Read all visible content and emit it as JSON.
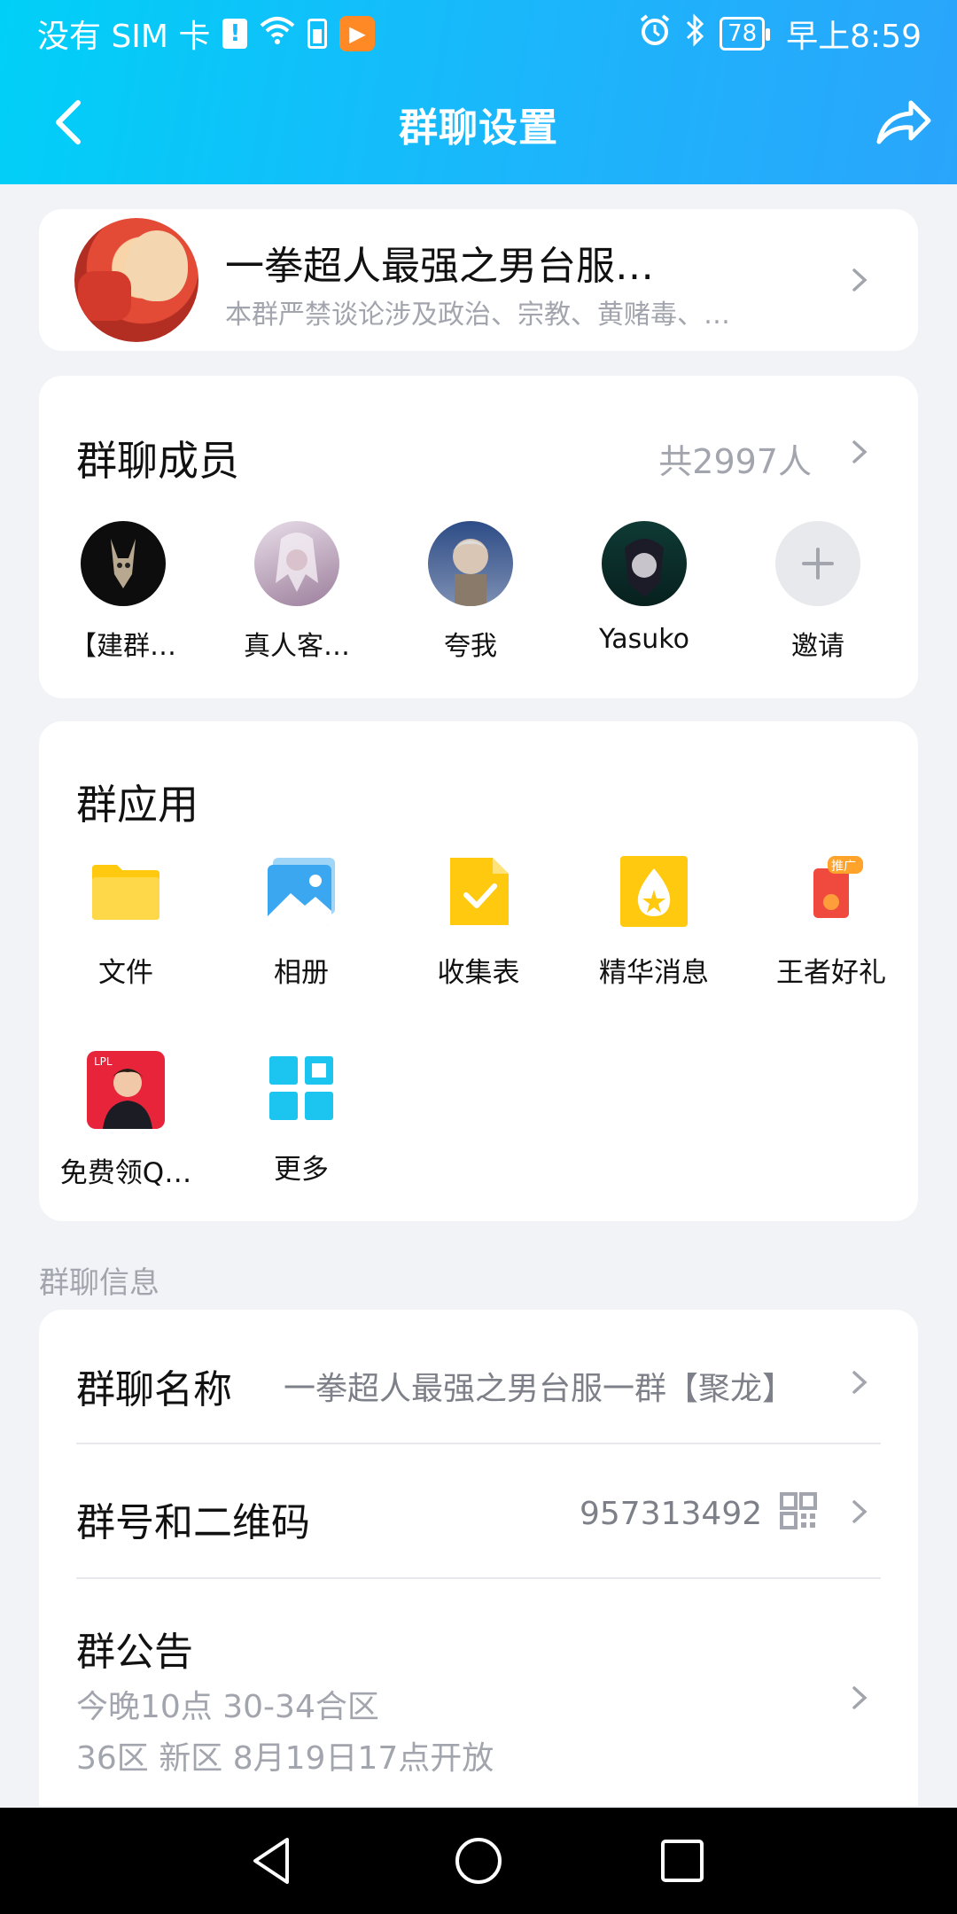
{
  "status_bar": {
    "carrier": "没有 SIM 卡",
    "battery": "78",
    "time": "早上8:59"
  },
  "header": {
    "title": "群聊设置"
  },
  "group": {
    "name": "一拳超人最强之男台服…",
    "description": "本群严禁谈论涉及政治、宗教、黄赌毒、…"
  },
  "members": {
    "title": "群聊成员",
    "count": "共2997人",
    "list": [
      {
        "name": "【建群…"
      },
      {
        "name": "真人客…"
      },
      {
        "name": "夸我"
      },
      {
        "name": "Yasuko"
      },
      {
        "name": "邀请"
      }
    ]
  },
  "apps": {
    "title": "群应用",
    "items": [
      {
        "label": "文件",
        "icon": "folder-icon"
      },
      {
        "label": "相册",
        "icon": "photo-album-icon"
      },
      {
        "label": "收集表",
        "icon": "form-check-icon"
      },
      {
        "label": "精华消息",
        "icon": "essence-message-icon"
      },
      {
        "label": "王者好礼",
        "icon": "gift-promo-icon",
        "badge": "推广"
      },
      {
        "label": "免费领Q…",
        "icon": "promo-image-icon"
      },
      {
        "label": "更多",
        "icon": "more-grid-icon"
      }
    ]
  },
  "info": {
    "section_label": "群聊信息",
    "name_label": "群聊名称",
    "name_value": "一拳超人最强之男台服一群【聚龙】",
    "number_label": "群号和二维码",
    "number_value": "957313492",
    "notice_label": "群公告",
    "notice_line1": "今晚10点 30-34合区",
    "notice_line2": "36区 新区 8月19日17点开放"
  },
  "colors": {
    "header_start": "#00d0f7",
    "header_end": "#2aa5fb",
    "app_yellow": "#ffc90f",
    "app_cyan": "#1cc4f0"
  }
}
